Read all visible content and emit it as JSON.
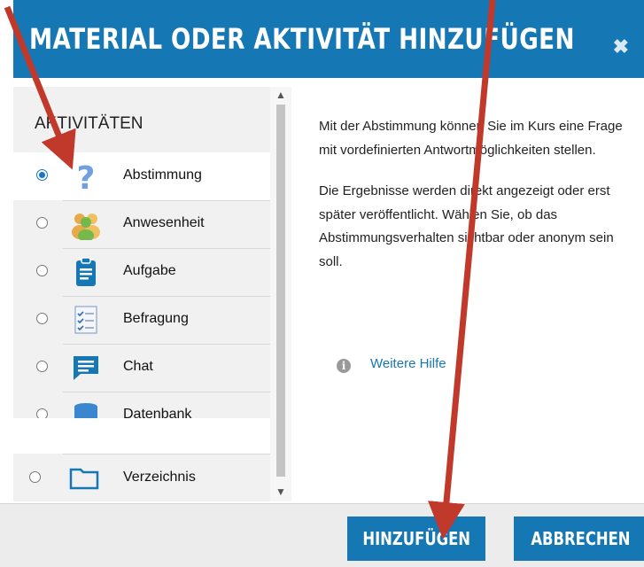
{
  "dialog": {
    "title": "MATERIAL ODER AKTIVITÄT HINZUFÜGEN",
    "close_label": "✖"
  },
  "activities": {
    "section_title": "AKTIVITÄTEN",
    "items": [
      {
        "label": "Abstimmung",
        "icon": "question-mark-icon",
        "selected": true
      },
      {
        "label": "Anwesenheit",
        "icon": "people-group-icon",
        "selected": false
      },
      {
        "label": "Aufgabe",
        "icon": "clipboard-icon",
        "selected": false
      },
      {
        "label": "Befragung",
        "icon": "checklist-icon",
        "selected": false
      },
      {
        "label": "Chat",
        "icon": "chat-bubble-icon",
        "selected": false
      },
      {
        "label": "Datenbank",
        "icon": "database-icon",
        "selected": false
      },
      {
        "label": "Verzeichnis",
        "icon": "folder-icon",
        "selected": false
      }
    ]
  },
  "description": {
    "paragraph1": "Mit der Abstimmung können Sie im Kurs eine Frage mit vordefinierten Antwortmöglichkeiten stellen.",
    "paragraph2": "Die Ergebnisse werden direkt angezeigt oder erst später veröffentlicht. Wählen Sie, ob das Abstimmungsverhalten sichtbar oder anonym sein soll.",
    "help_link": "Weitere Hilfe"
  },
  "buttons": {
    "add": "HINZUFÜGEN",
    "cancel": "ABBRECHEN"
  },
  "colors": {
    "accent": "#1577b4",
    "annotation_arrow": "#c0392b"
  }
}
